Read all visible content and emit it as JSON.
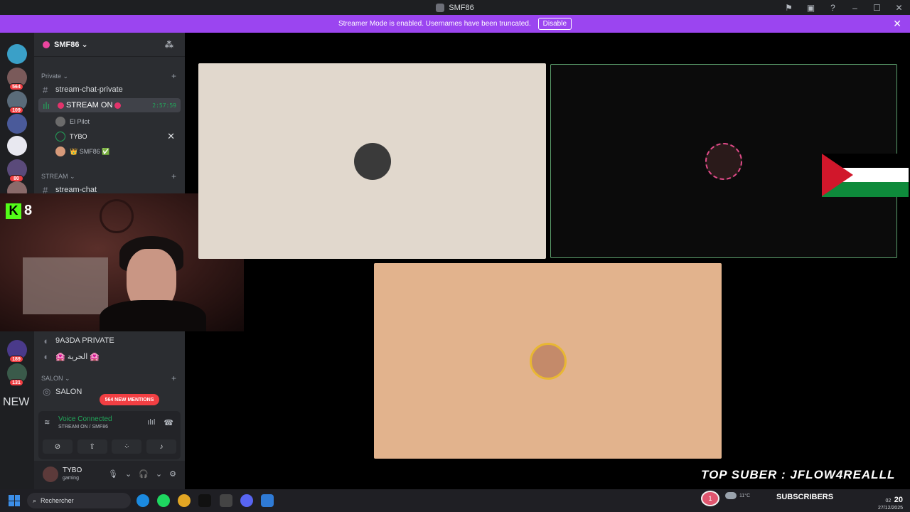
{
  "titlebar": {
    "title": "SMF86"
  },
  "banner": {
    "message": "Streamer Mode is enabled. Usernames have been truncated.",
    "disable_label": "Disable",
    "close_glyph": "✕"
  },
  "servers": [
    {
      "badge": ""
    },
    {
      "badge": "564"
    },
    {
      "badge": "109"
    },
    {
      "badge": ""
    },
    {
      "badge": ""
    },
    {
      "badge": "80"
    },
    {
      "badge": ""
    },
    {
      "badge": "189"
    },
    {
      "badge": "131"
    }
  ],
  "rail": {
    "new_label": "NEW"
  },
  "guild": {
    "name": "SMF86 ⌄"
  },
  "categories": {
    "private": "Private ⌄",
    "stream": "STREAM ⌄",
    "salon": "SALON ⌄"
  },
  "channels": {
    "stream_chat_private": "stream-chat-private",
    "stream_on": "STREAM ON",
    "stream_on_timer": "2:57:59",
    "stream_chat": "stream-chat",
    "private_9a3da": "9A3DA PRIVATE",
    "horria": "🏩 الحرية 🏩",
    "salon": "SALON"
  },
  "voice_users": [
    {
      "name": "El Pilot"
    },
    {
      "name": "TYBO"
    },
    {
      "name": "👑 SMF86 ✅"
    }
  ],
  "mentions": {
    "label": "564 NEW MENTIONS"
  },
  "voice_panel": {
    "status": "Voice Connected",
    "channel": "STREAM ON / SMF86"
  },
  "user_panel": {
    "name": "TYBO",
    "status": "gaming"
  },
  "overlay": {
    "kick_count": "8",
    "top_suber": "TOP SUBER : JFLOW4REALLL"
  },
  "taskbar": {
    "search_placeholder": "Rechercher",
    "notif_count": "1",
    "weather_temp": "11°C",
    "subscribers_label": "SUBSCRIBERS",
    "time_big": "20",
    "time_small": "02",
    "date": "27/12/2025"
  },
  "colors": {
    "banner": "#9b45f0",
    "tile1": "#e1d8cd",
    "tile3": "#e2b38d",
    "green": "#23a55a",
    "red": "#f23f43"
  }
}
